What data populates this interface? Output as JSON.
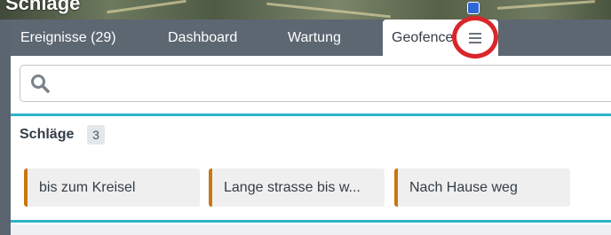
{
  "map": {
    "edge_text": "Schläge"
  },
  "tabs": [
    {
      "label": "Ereignisse (29)",
      "active": false
    },
    {
      "label": "Dashboard",
      "active": false
    },
    {
      "label": "Wartung",
      "active": false
    },
    {
      "label": "Geofence",
      "active": true
    }
  ],
  "menu": {
    "icon": "hamburger-menu-icon"
  },
  "search": {
    "value": "",
    "placeholder": "",
    "icon": "search-icon"
  },
  "section": {
    "title": "Schläge",
    "count": "3"
  },
  "cards": [
    {
      "label": "bis zum Kreisel"
    },
    {
      "label": "Lange strasse bis w..."
    },
    {
      "label": "Nach Hause weg"
    }
  ],
  "colors": {
    "tabbar_bg": "#5d6772",
    "accent_line": "#2cb5c9",
    "card_bar": "#c8780f",
    "highlight": "#d9262a"
  }
}
